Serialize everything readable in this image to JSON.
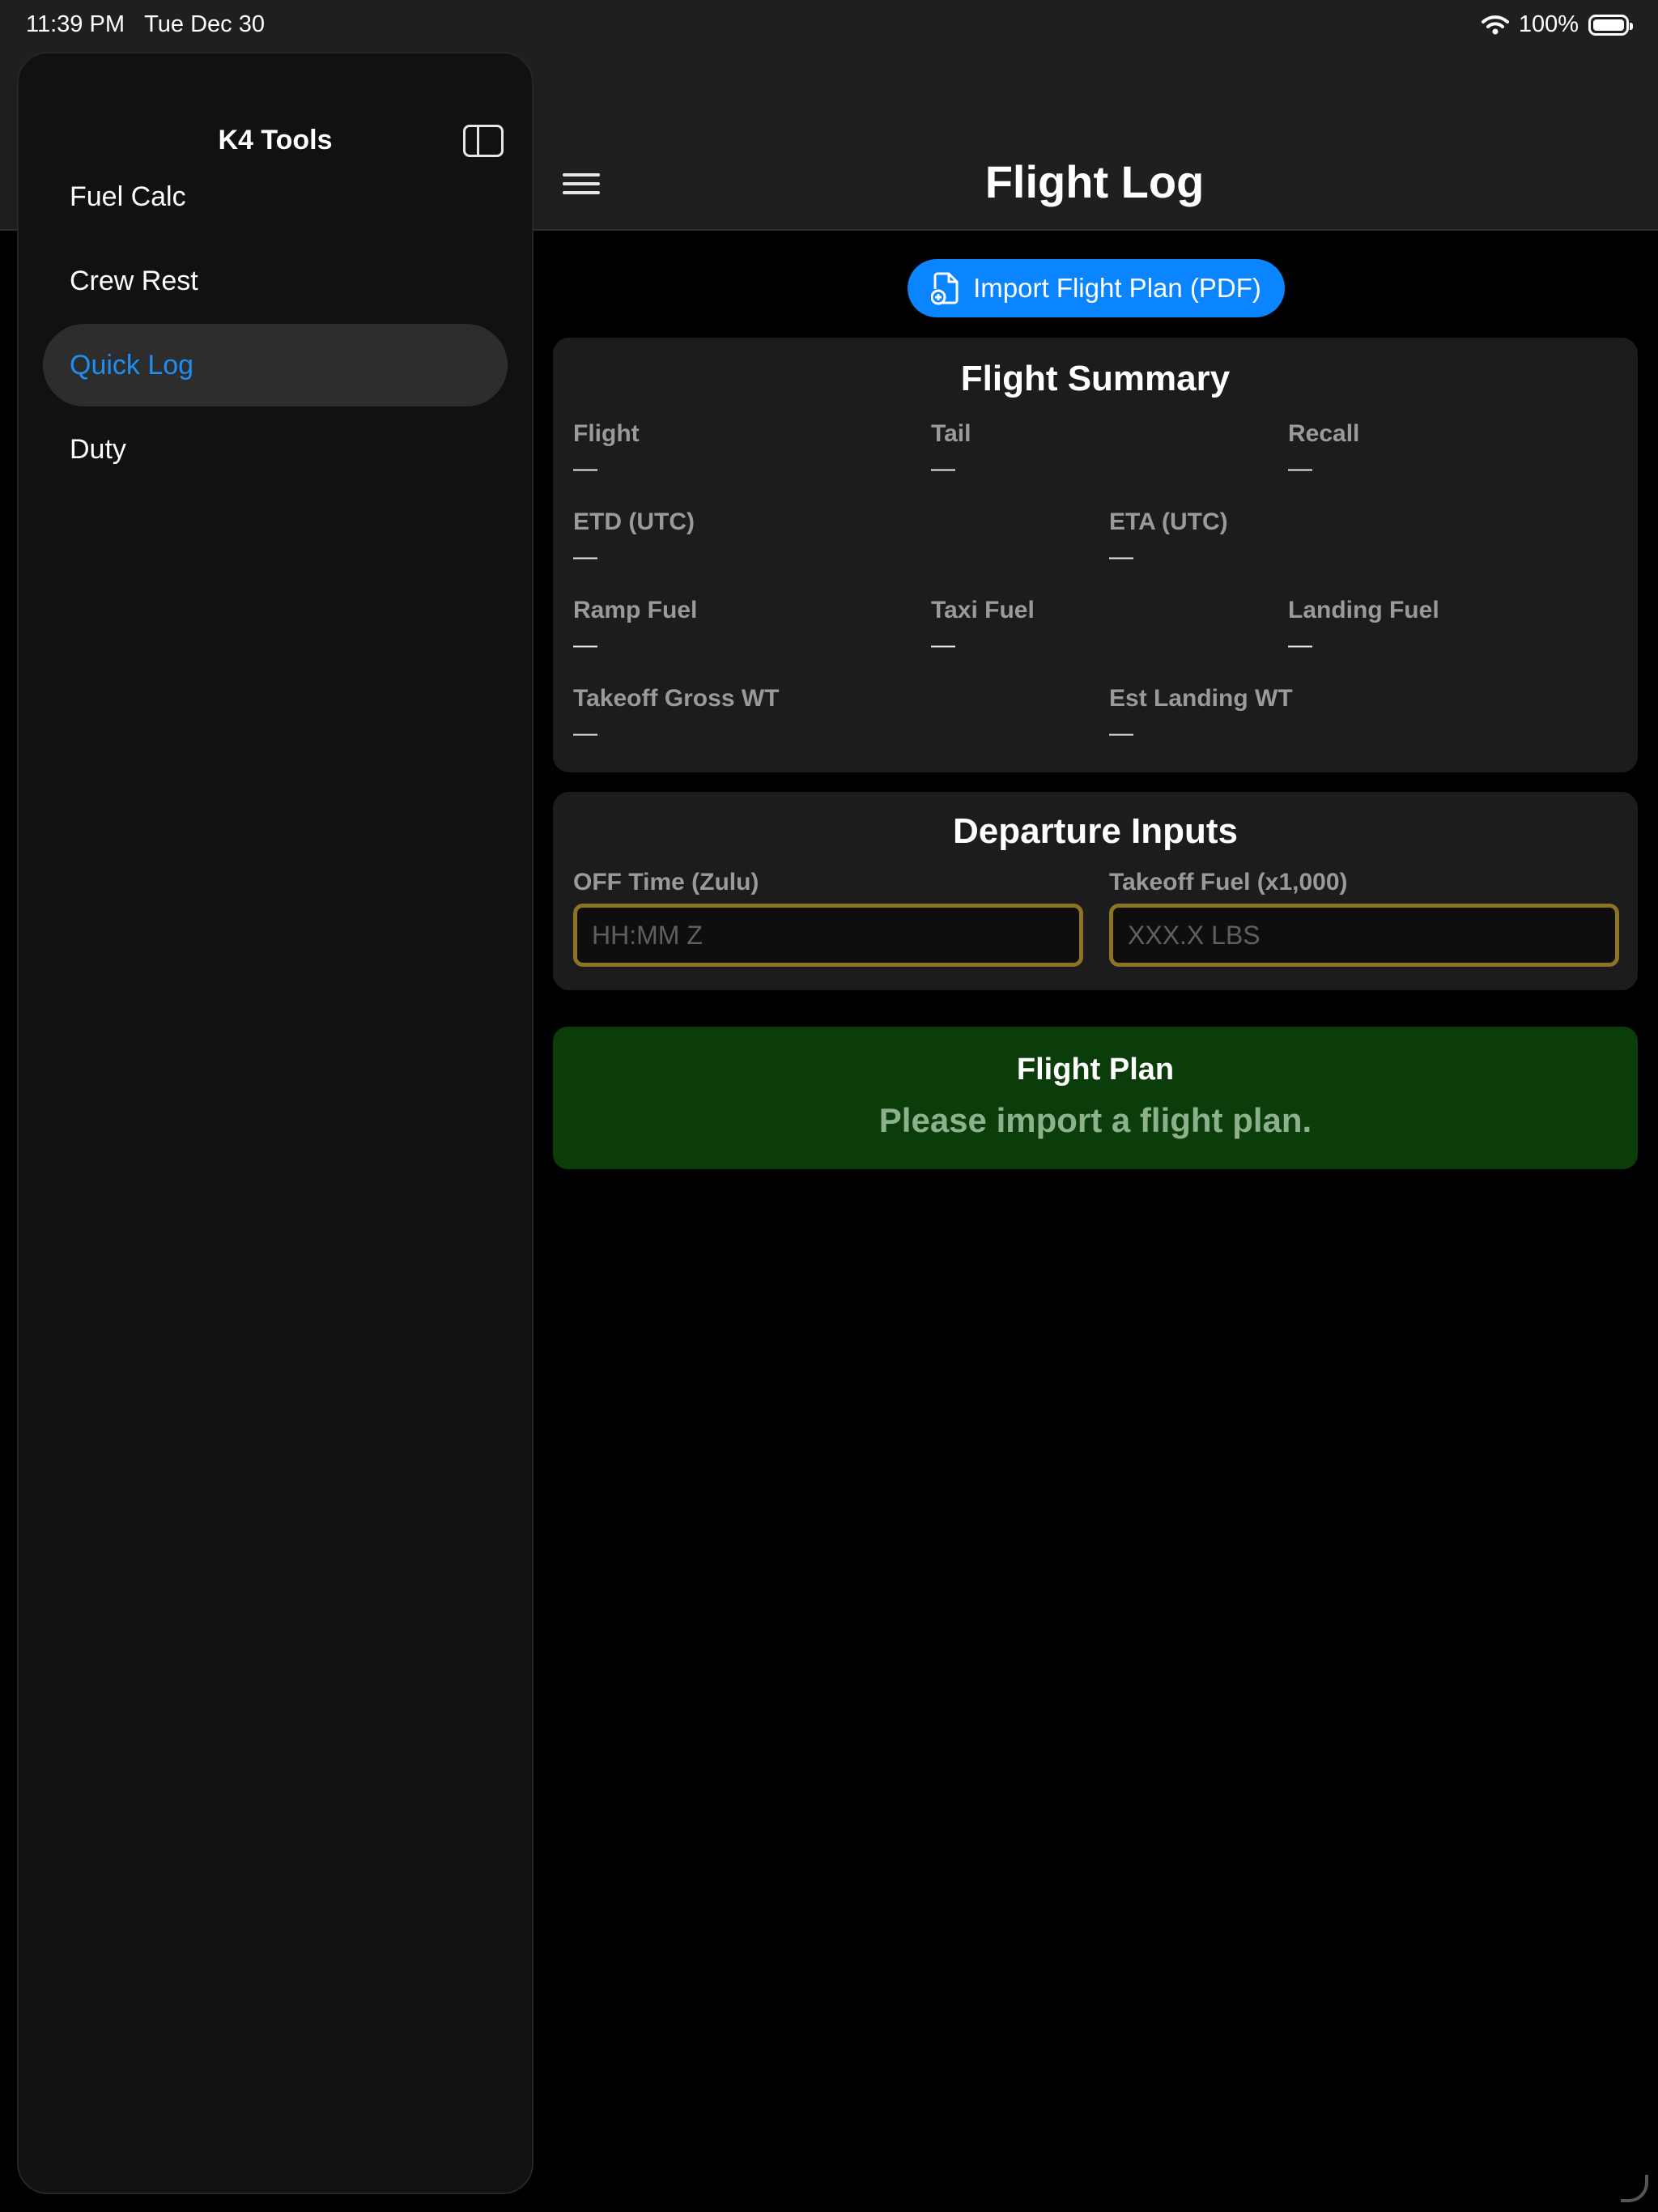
{
  "status": {
    "time": "11:39 PM",
    "date": "Tue Dec 30",
    "battery": "100%"
  },
  "sidebar": {
    "title": "K4 Tools",
    "items": [
      {
        "label": "Fuel Calc"
      },
      {
        "label": "Crew Rest"
      },
      {
        "label": "Quick Log",
        "active": true
      },
      {
        "label": "Duty"
      }
    ]
  },
  "header": {
    "title": "Flight Log"
  },
  "import_button": {
    "label": "Import Flight Plan (PDF)",
    "color": "#0a84ff"
  },
  "summary": {
    "title": "Flight Summary",
    "fields": {
      "flight": {
        "label": "Flight",
        "value": "—"
      },
      "tail": {
        "label": "Tail",
        "value": "—"
      },
      "recall": {
        "label": "Recall",
        "value": "—"
      },
      "etd": {
        "label": "ETD (UTC)",
        "value": "—"
      },
      "eta": {
        "label": "ETA (UTC)",
        "value": "—"
      },
      "ramp_fuel": {
        "label": "Ramp Fuel",
        "value": "—"
      },
      "taxi_fuel": {
        "label": "Taxi Fuel",
        "value": "—"
      },
      "landing_fuel": {
        "label": "Landing Fuel",
        "value": "—"
      },
      "takeoff_gross_wt": {
        "label": "Takeoff Gross WT",
        "value": "—"
      },
      "est_landing_wt": {
        "label": "Est Landing WT",
        "value": "—"
      }
    }
  },
  "departure": {
    "title": "Departure Inputs",
    "off_time": {
      "label": "OFF Time (Zulu)",
      "placeholder": "HH:MM Z",
      "value": ""
    },
    "takeoff_fuel": {
      "label": "Takeoff Fuel (x1,000)",
      "placeholder": "XXX.X LBS",
      "value": ""
    }
  },
  "flight_plan": {
    "title": "Flight Plan",
    "message": "Please import a flight plan."
  },
  "colors": {
    "accent": "#1e8ff0",
    "input_border": "#8b7422",
    "plan_bg": "#0b3d0b"
  }
}
